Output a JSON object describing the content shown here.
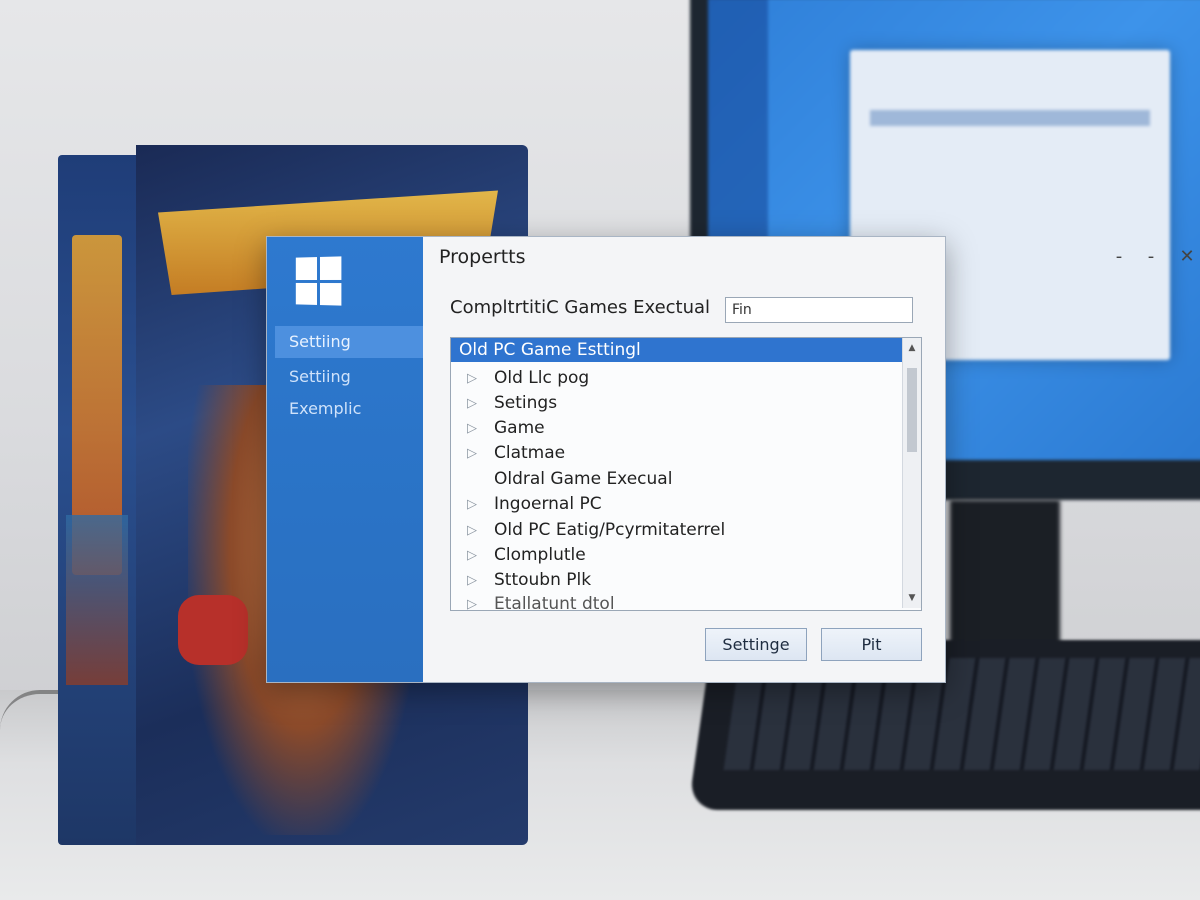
{
  "dialog": {
    "title": "Propertts",
    "minimize_glyph": "-",
    "restore_glyph": "-",
    "close_glyph": "✕",
    "label": "CompltrtitiC Games Exectual",
    "field_value": "Fin",
    "sidebar": {
      "items": [
        {
          "label": "Settiing",
          "active": true
        },
        {
          "label": "Settiing"
        },
        {
          "label": "Exemplic"
        }
      ]
    },
    "list": {
      "header": "Old PC Game Esttingl",
      "items": [
        {
          "label": "Old Llc pog",
          "arrow": "▷"
        },
        {
          "label": "Setings",
          "arrow": "▷"
        },
        {
          "label": "Game",
          "arrow": "▷"
        },
        {
          "label": "Clatmae",
          "arrow": "▷"
        },
        {
          "label": "Oldral Game Execual",
          "arrow": ""
        },
        {
          "label": "Ingoernal PC",
          "arrow": "▷"
        },
        {
          "label": "Old PC Eatig/Pcyrmitaterrel",
          "arrow": "▷"
        },
        {
          "label": "Clomplutle",
          "arrow": "▷"
        },
        {
          "label": "Sttoubn Plk",
          "arrow": "▷"
        },
        {
          "label": "Etallatunt dtol",
          "arrow": "▷"
        }
      ],
      "scroll_up": "▲",
      "scroll_down": "▼"
    },
    "buttons": {
      "settings": "Settinge",
      "pit": "Pit"
    }
  },
  "colors": {
    "sidebar": "#2e79cf",
    "selection": "#2f74cf"
  }
}
